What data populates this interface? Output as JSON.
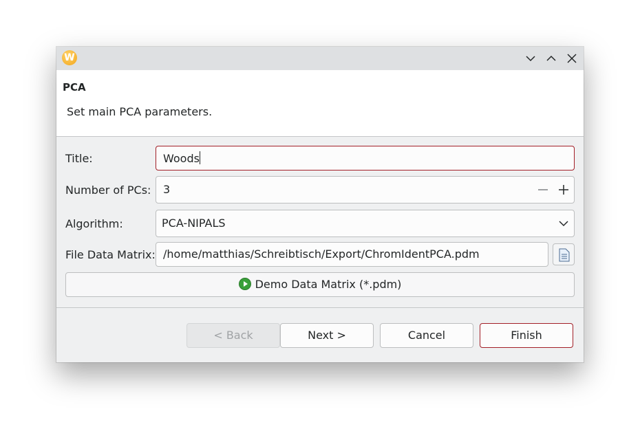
{
  "window": {
    "app_icon_letter": "W",
    "controls": {
      "minimize": "chevron-down-icon",
      "maximize": "chevron-up-icon",
      "close": "close-icon"
    }
  },
  "header": {
    "title": "PCA",
    "description": "Set main PCA parameters."
  },
  "form": {
    "title_label": "Title:",
    "title_value": "Woods",
    "pcs_label": "Number of PCs:",
    "pcs_value": "3",
    "algorithm_label": "Algorithm:",
    "algorithm_value": "PCA-NIPALS",
    "file_label": "File Data Matrix:",
    "file_value": "/home/matthias/Schreibtisch/Export/ChromIdentPCA.pdm",
    "demo_button": "Demo Data Matrix (*.pdm)"
  },
  "buttons": {
    "back": "< Back",
    "next": "Next >",
    "cancel": "Cancel",
    "finish": "Finish"
  },
  "colors": {
    "focus_accent": "#a21e26",
    "play_icon": "#3aa03a"
  }
}
